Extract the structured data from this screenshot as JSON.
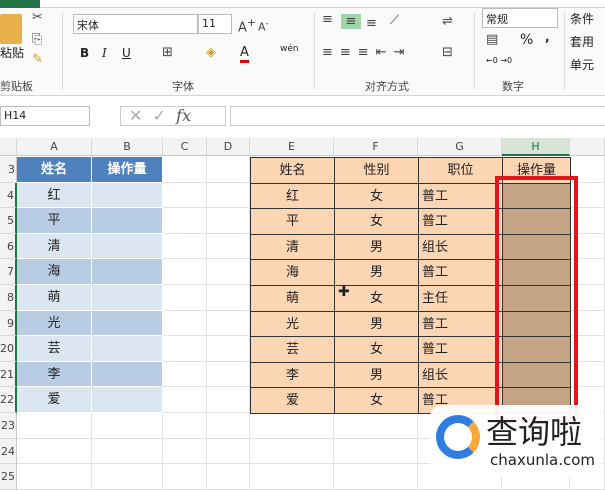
{
  "ribbon": {
    "clipboard": {
      "paste": "粘贴",
      "label": "剪贴板"
    },
    "font": {
      "name": "宋体",
      "size": "11",
      "label": "字体",
      "bold": "B",
      "italic": "I",
      "underline": "U",
      "phonetic": "wén"
    },
    "alignment": {
      "label": "对齐方式"
    },
    "number": {
      "format": "常规",
      "label": "数字",
      "percent": "%",
      "comma": ","
    },
    "styles": {
      "items": [
        "条件",
        "套用",
        "单元"
      ]
    }
  },
  "formula_bar": {
    "name_box": "H14",
    "fx": "fx",
    "value": ""
  },
  "columns": [
    "A",
    "B",
    "C",
    "D",
    "E",
    "F",
    "G",
    "H"
  ],
  "rows": [
    "3",
    "4",
    "5",
    "6",
    "7",
    "8",
    "9",
    "20",
    "21",
    "22",
    "23",
    "24",
    "25"
  ],
  "table1": {
    "headers": [
      "姓名",
      "操作量"
    ],
    "names": [
      "红",
      "平",
      "清",
      "海",
      "萌",
      "光",
      "芸",
      "李",
      "爱"
    ]
  },
  "table2": {
    "headers": [
      "姓名",
      "性别",
      "职位",
      "操作量"
    ],
    "rows": [
      [
        "红",
        "女",
        "普工"
      ],
      [
        "平",
        "女",
        "普工"
      ],
      [
        "清",
        "男",
        "组长"
      ],
      [
        "海",
        "男",
        "普工"
      ],
      [
        "萌",
        "女",
        "主任"
      ],
      [
        "光",
        "男",
        "普工"
      ],
      [
        "芸",
        "女",
        "普工"
      ],
      [
        "李",
        "男",
        "组长"
      ],
      [
        "爱",
        "女",
        "普工"
      ]
    ]
  },
  "watermark": {
    "brand": "查询啦",
    "url": "chaxunla.com"
  },
  "colors": {
    "header_blue": "#4f81bd",
    "band_light": "#dce6f1",
    "band_dark": "#b8cce4",
    "peach": "#fcd5b4",
    "brown": "#c4a484",
    "red": "#e0161b"
  }
}
